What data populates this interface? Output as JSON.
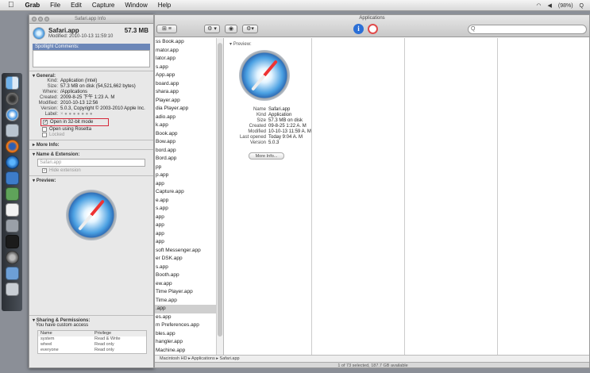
{
  "menubar": {
    "apple": "",
    "items": [
      "Grab",
      "File",
      "Edit",
      "Capture",
      "Window",
      "Help"
    ],
    "right": [
      "(98%)",
      "Q"
    ]
  },
  "info_panel": {
    "window_title": "Safari.app Info",
    "name": "Safari.app",
    "size": "57.3 MB",
    "modified": "Modified: 2010-10-13 11:59:10",
    "spotlight_header": "Spotlight Comments:",
    "general": {
      "header": "General:",
      "rows": [
        {
          "k": "Kind:",
          "v": "Application (Intel)"
        },
        {
          "k": "Size:",
          "v": "57.3 MB on disk (54,521,662 bytes)"
        },
        {
          "k": "Where:",
          "v": "/Applications"
        },
        {
          "k": "Created:",
          "v": "2009-8-25 下午 1:23 A. M"
        },
        {
          "k": "Modified:",
          "v": "2010-10-13 12:56"
        },
        {
          "k": "Version:",
          "v": "5.0.3, Copyright © 2003-2010 Apple Inc."
        },
        {
          "k": "Label:",
          "v": "× ● ● ● ● ● ● ●"
        }
      ],
      "open_32": "Open in 32-bit mode",
      "open_rosetta": "Open using Rosetta",
      "locked": "Locked"
    },
    "more_info": "More Info:",
    "name_ext": {
      "header": "Name & Extension:",
      "field": "Safari.app",
      "hide_ext": "Hide extension"
    },
    "preview_header": "Preview:",
    "sharing": {
      "header": "Sharing & Permissions:",
      "note": "You have custom access",
      "col_name": "Name",
      "col_priv": "Privilege",
      "rows": [
        {
          "name": "system",
          "priv": "Read & Write"
        },
        {
          "name": "wheel",
          "priv": "Read only"
        },
        {
          "name": "everyone",
          "priv": "Read only"
        }
      ]
    }
  },
  "finder": {
    "title": "Applications",
    "search_placeholder": "Q",
    "view_btn": "⊞  ≡",
    "action_btn": "⚙ ▾",
    "eye_btn": "👁",
    "info_btn": "i",
    "apps": [
      "ss Book.app",
      "mator.app",
      "lator.app",
      "s.app",
      "App.app",
      "board.app",
      "shara.app",
      "Player.app",
      "dia Player.app",
      "adio.app",
      "k.app",
      "Book.app",
      "Bow.app",
      "bord.app",
      "Bord.app",
      "pp",
      "p.app",
      "app",
      "Capture.app",
      "e.app",
      "s.app",
      "app",
      "app",
      "app",
      "app",
      "soft Messenger.app",
      "er DSK.app",
      "s.app",
      "Booth.app",
      "ew.app",
      "Time Player.app",
      "Time.app",
      ".app",
      "es.app",
      "m Preferences.app",
      "bles.app",
      "hangler.app",
      "Machine.app"
    ],
    "selected_index": 32,
    "preview_label": "Preview:",
    "meta": [
      {
        "k": "Name",
        "v": "Safari.app"
      },
      {
        "k": "Kind",
        "v": "Application"
      },
      {
        "k": "Size",
        "v": "57.3 MB on disk"
      },
      {
        "k": "Created",
        "v": "09-8-25 1:22 A. M"
      },
      {
        "k": "Modified",
        "v": "10-10-13 11:59 A. M"
      },
      {
        "k": "Last opened",
        "v": "Today 9:04 A. M"
      },
      {
        "k": "Version",
        "v": "5.0.3"
      }
    ],
    "more_info_btn": "More Info...",
    "pathbar": "Macintosh HD ▸ Applications ▸ Safari.app",
    "status": "1 of 73 selected, 187.7 GB available"
  }
}
